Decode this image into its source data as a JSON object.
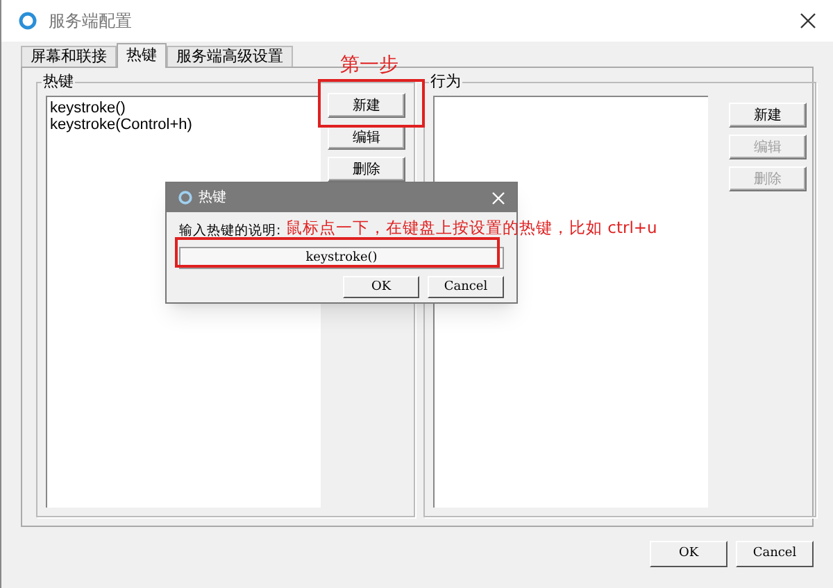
{
  "window": {
    "title": "服务端配置"
  },
  "tabs": [
    {
      "label": "屏幕和联接",
      "selected": false
    },
    {
      "label": "热键",
      "selected": true
    },
    {
      "label": "服务端高级设置",
      "selected": false
    }
  ],
  "hotkey_group": {
    "title": "热键",
    "items": [
      {
        "label": "keystroke()"
      },
      {
        "label": "keystroke(Control+h)"
      }
    ],
    "buttons": [
      {
        "label": "新建",
        "disabled": false
      },
      {
        "label": "编辑",
        "disabled": false
      },
      {
        "label": "删除",
        "disabled": false
      }
    ]
  },
  "action_group": {
    "title": "行为",
    "buttons": [
      {
        "label": "新建",
        "disabled": false
      },
      {
        "label": "编辑",
        "disabled": true
      },
      {
        "label": "删除",
        "disabled": true
      }
    ]
  },
  "footer_buttons": [
    "OK",
    "Cancel"
  ],
  "dialog": {
    "title": "热键",
    "prompt": "输入热键的说明:",
    "value": "keystroke()",
    "buttons": [
      "OK",
      "Cancel"
    ]
  },
  "annotations": [
    "第一步",
    "鼠标点一下，在键盘上按设置的热键，比如 ctrl+u"
  ]
}
